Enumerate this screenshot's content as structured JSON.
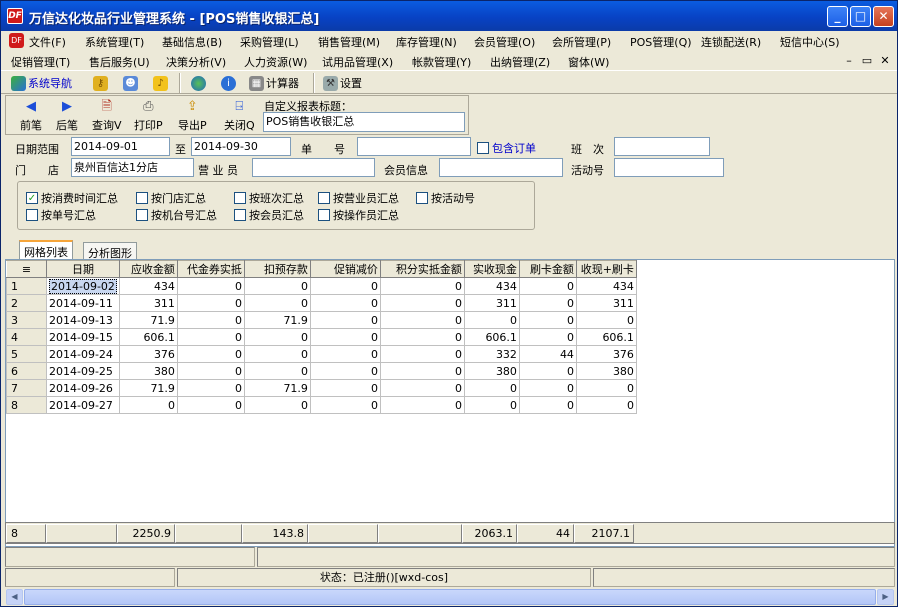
{
  "window": {
    "title": "万信达化妆品行业管理系统 - [POS销售收银汇总]",
    "icon_text": "DF"
  },
  "menu1": [
    "文件(F)",
    "系统管理(T)",
    "基础信息(B)",
    "采购管理(L)",
    "销售管理(M)",
    "库存管理(N)",
    "会员管理(O)",
    "会所管理(P)",
    "POS管理(Q)",
    "连锁配送(R)",
    "短信中心(S)"
  ],
  "menu2": [
    "促销管理(T)",
    "售后服务(U)",
    "决策分析(V)",
    "人力资源(W)",
    "试用品管理(X)",
    "帐款管理(Y)",
    "出纳管理(Z)",
    "窗体(W)"
  ],
  "toolbar": {
    "nav_label": "系统导航",
    "calc_label": "计算器",
    "settings_label": "设置"
  },
  "actions": {
    "prev": "前笔",
    "next": "后笔",
    "query": "查询V",
    "print": "打印P",
    "export": "导出P",
    "close": "关闭Q"
  },
  "report": {
    "title_label": "自定义报表标题：",
    "title_value": "POS销售收银汇总"
  },
  "filters": {
    "date_range_label": "日期范围",
    "date_from": "2014-09-01",
    "to_label": "至",
    "date_to": "2014-09-30",
    "bill_label": "单　　号",
    "include_order_label": "包含订单",
    "shift_label": "班　次",
    "store_label": "门　　店",
    "store_value": "泉州百信达1分店",
    "salesperson_label": "营 业 员",
    "member_label": "会员信息",
    "activity_label": "活动号"
  },
  "group_options": [
    {
      "label": "按消费时间汇总",
      "checked": true
    },
    {
      "label": "按门店汇总",
      "checked": false
    },
    {
      "label": "按班次汇总",
      "checked": false
    },
    {
      "label": "按营业员汇总",
      "checked": false
    },
    {
      "label": "按活动号",
      "checked": false
    },
    {
      "label": "按单号汇总",
      "checked": false
    },
    {
      "label": "按机台号汇总",
      "checked": false
    },
    {
      "label": "按会员汇总",
      "checked": false
    },
    {
      "label": "按操作员汇总",
      "checked": false
    }
  ],
  "tabs": [
    "网格列表",
    "分析图形"
  ],
  "table": {
    "columns": [
      "日期",
      "应收金额",
      "代金券实抵",
      "扣预存款",
      "促销减价",
      "积分实抵金额",
      "实收现金",
      "刷卡金额",
      "收现+刷卡"
    ],
    "rows": [
      [
        "1",
        "2014-09-02",
        "434",
        "0",
        "0",
        "0",
        "0",
        "434",
        "0",
        "434"
      ],
      [
        "2",
        "2014-09-11",
        "311",
        "0",
        "0",
        "0",
        "0",
        "311",
        "0",
        "311"
      ],
      [
        "3",
        "2014-09-13",
        "71.9",
        "0",
        "71.9",
        "0",
        "0",
        "0",
        "0",
        "0"
      ],
      [
        "4",
        "2014-09-15",
        "606.1",
        "0",
        "0",
        "0",
        "0",
        "606.1",
        "0",
        "606.1"
      ],
      [
        "5",
        "2014-09-24",
        "376",
        "0",
        "0",
        "0",
        "0",
        "332",
        "44",
        "376"
      ],
      [
        "6",
        "2014-09-25",
        "380",
        "0",
        "0",
        "0",
        "0",
        "380",
        "0",
        "380"
      ],
      [
        "7",
        "2014-09-26",
        "71.9",
        "0",
        "71.9",
        "0",
        "0",
        "0",
        "0",
        "0"
      ],
      [
        "8",
        "2014-09-27",
        "0",
        "0",
        "0",
        "0",
        "0",
        "0",
        "0",
        "0"
      ]
    ],
    "footer": {
      "count": "8",
      "receivable": "2250.9",
      "prepaid": "143.8",
      "cash": "2063.1",
      "card": "44",
      "cash_card": "2107.1"
    }
  },
  "status": {
    "text": "状态：已注册()[wxd-cos]"
  }
}
